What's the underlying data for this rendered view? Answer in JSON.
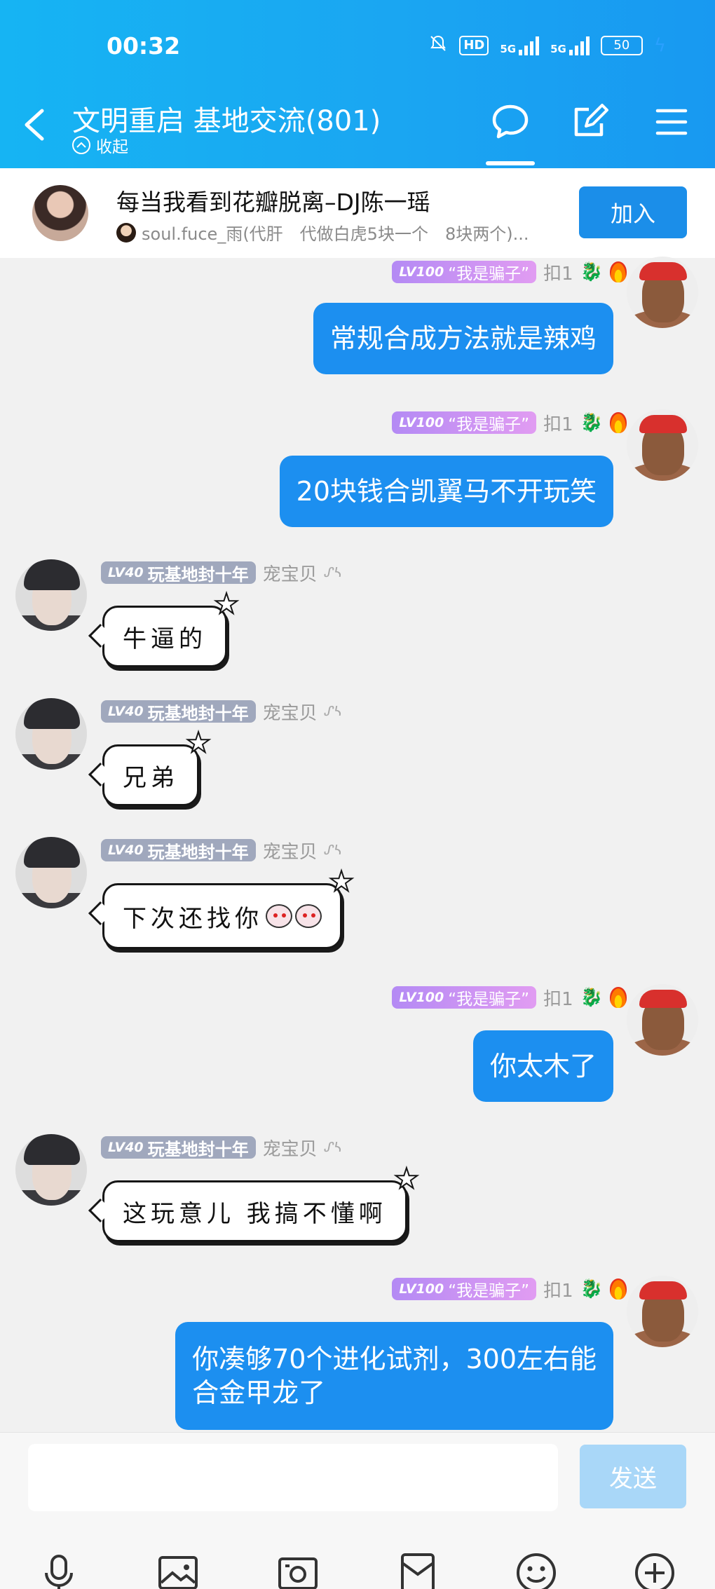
{
  "status": {
    "time": "00:32",
    "hd": "HD",
    "net1": "5G",
    "net2": "5G",
    "battery": "50"
  },
  "header": {
    "title": "文明重启 基地交流(801)",
    "collapse": "收起"
  },
  "notice": {
    "title": "每当我看到花瓣脱离–DJ陈一瑶",
    "sub": "soul.fuce_雨(代肝　代做白虎5块一个　8块两个)...",
    "join": "加入"
  },
  "colors": {
    "brand": "#1aa6f2",
    "bubble": "#1c8ff0",
    "send_disabled": "#a9d7f8"
  },
  "messages": [
    {
      "side": "right",
      "level": "LV100",
      "title": "“我是骗子”",
      "sender": "扣1",
      "text": "常规合成方法就是辣鸡"
    },
    {
      "side": "right",
      "level": "LV100",
      "title": "“我是骗子”",
      "sender": "扣1",
      "text": "20块钱合凯翼马不开玩笑"
    },
    {
      "side": "left",
      "level": "LV40",
      "title": "玩基地封十年",
      "sender": "宠宝贝",
      "text": "牛逼的"
    },
    {
      "side": "left",
      "level": "LV40",
      "title": "玩基地封十年",
      "sender": "宠宝贝",
      "text": "兄弟"
    },
    {
      "side": "left",
      "level": "LV40",
      "title": "玩基地封十年",
      "sender": "宠宝贝",
      "text": "下次还找你"
    },
    {
      "side": "right",
      "level": "LV100",
      "title": "“我是骗子”",
      "sender": "扣1",
      "text": "你太木了"
    },
    {
      "side": "left",
      "level": "LV40",
      "title": "玩基地封十年",
      "sender": "宠宝贝",
      "text": "这玩意儿 我搞不懂啊"
    },
    {
      "side": "right",
      "level": "LV100",
      "title": "“我是骗子”",
      "sender": "扣1",
      "line1": "你凑够70个进化试剂，300左右能",
      "line2": "合金甲龙了"
    }
  ],
  "input": {
    "send": "发送"
  }
}
